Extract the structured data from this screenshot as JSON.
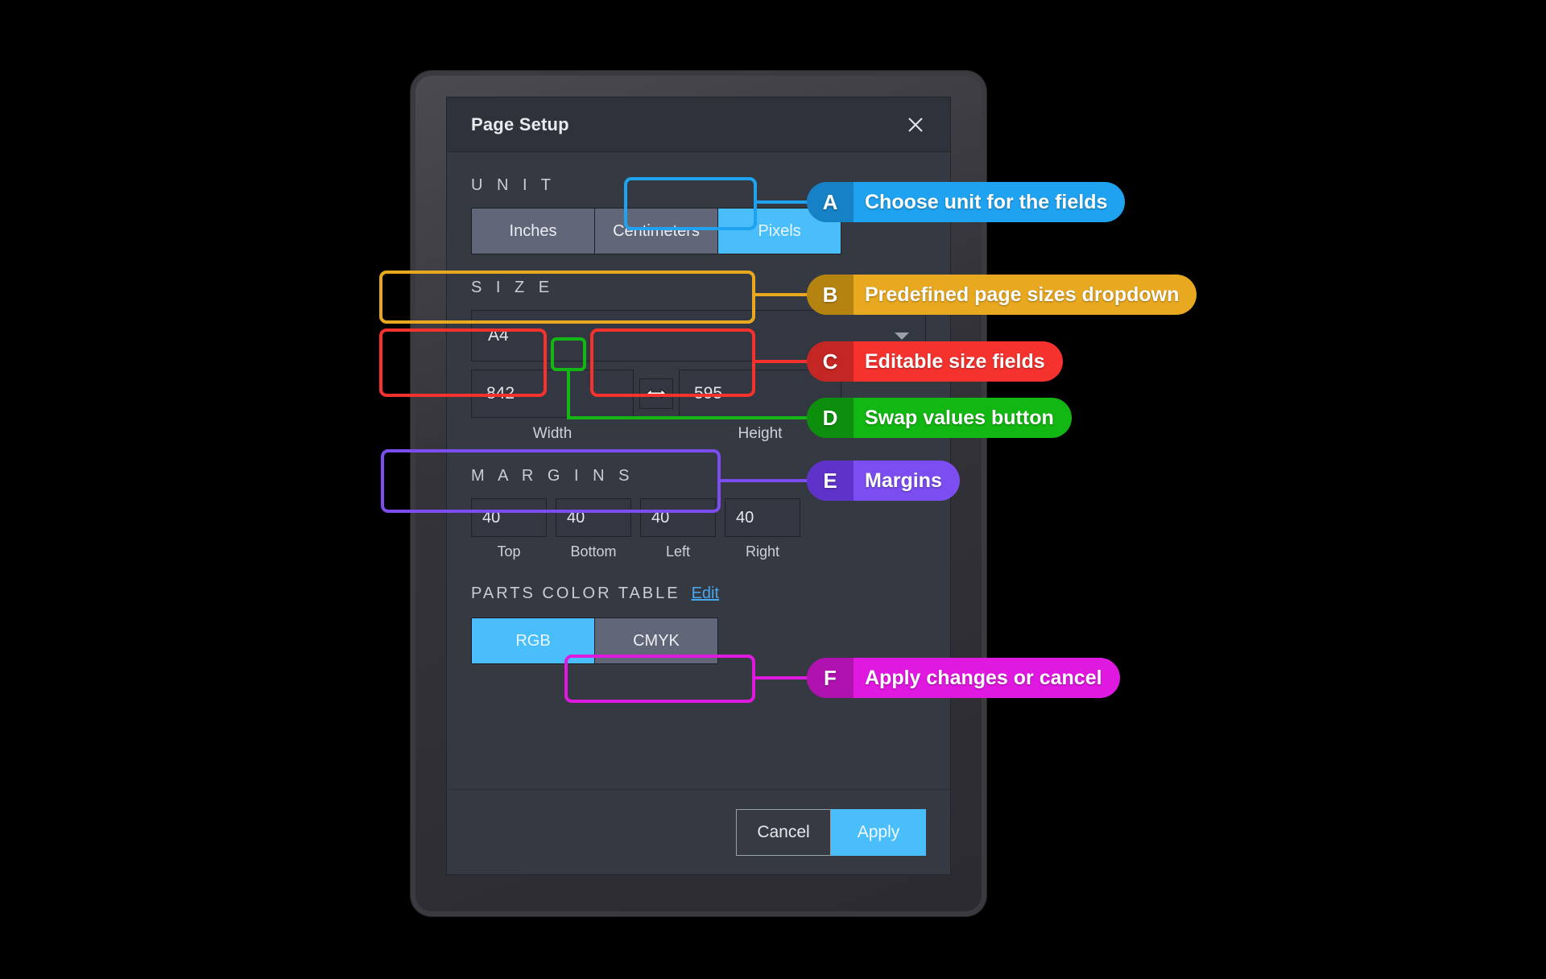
{
  "dialog": {
    "title": "Page Setup",
    "close_icon": "close-icon"
  },
  "unit": {
    "label": "U N I T",
    "options": [
      "Inches",
      "Centimeters",
      "Pixels"
    ],
    "selected": "Pixels"
  },
  "size": {
    "label": "S I Z E",
    "preset": "A4",
    "width": {
      "value": "842",
      "caption": "Width"
    },
    "height": {
      "value": "595",
      "caption": "Height"
    },
    "swap_icon": "swap-horizontal-icon"
  },
  "margins": {
    "label": "M A R G I N S",
    "fields": [
      {
        "value": "40",
        "caption": "Top"
      },
      {
        "value": "40",
        "caption": "Bottom"
      },
      {
        "value": "40",
        "caption": "Left"
      },
      {
        "value": "40",
        "caption": "Right"
      }
    ]
  },
  "parts_color_table": {
    "label": "PARTS COLOR TABLE",
    "edit_link": "Edit",
    "options": [
      "RGB",
      "CMYK"
    ],
    "selected": "RGB"
  },
  "footer": {
    "cancel": "Cancel",
    "apply": "Apply"
  },
  "callouts": [
    {
      "letter": "A",
      "text": "Choose unit for the fields",
      "color": "#1fa2f0",
      "letter_color": "#1681c4"
    },
    {
      "letter": "B",
      "text": "Predefined page sizes dropdown",
      "color": "#e8a820",
      "letter_color": "#b5830f"
    },
    {
      "letter": "C",
      "text": "Editable size fields",
      "color": "#f5322e",
      "letter_color": "#c42623"
    },
    {
      "letter": "D",
      "text": "Swap values button",
      "color": "#13b713",
      "letter_color": "#0d8f0d"
    },
    {
      "letter": "E",
      "text": "Margins",
      "color": "#7c4df0",
      "letter_color": "#5f33c9"
    },
    {
      "letter": "F",
      "text": "Apply changes or cancel",
      "color": "#e019e0",
      "letter_color": "#b012b0"
    }
  ]
}
